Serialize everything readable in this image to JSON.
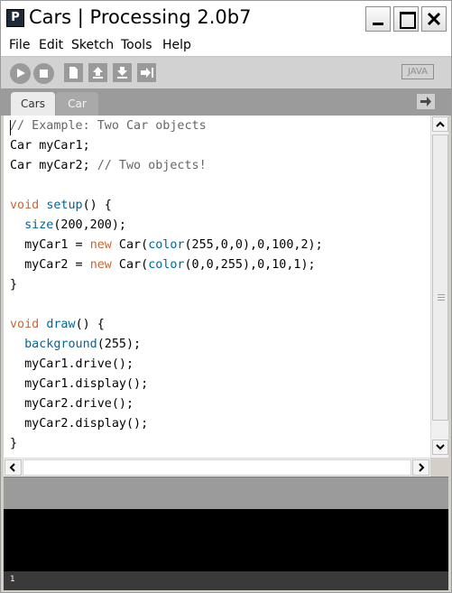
{
  "window": {
    "title": "Cars | Processing 2.0b7",
    "icon_letter": "P"
  },
  "menubar": {
    "items": [
      "File",
      "Edit",
      "Sketch",
      "Tools",
      "Help"
    ]
  },
  "toolbar": {
    "buttons": [
      "play-icon",
      "stop-icon",
      "new-icon",
      "open-icon",
      "save-icon",
      "export-icon"
    ],
    "mode": "JAVA"
  },
  "tabs": {
    "items": [
      {
        "label": "Cars",
        "active": true
      },
      {
        "label": "Car",
        "active": false
      }
    ],
    "menu_icon": "arrow-right-icon"
  },
  "editor": {
    "lines": [
      "// Example: Two Car objects",
      "Car myCar1;",
      "Car myCar2; // Two objects!",
      "",
      "void setup() {",
      "  size(200,200);",
      "  myCar1 = new Car(color(255,0,0),0,100,2);",
      "  myCar2 = new Car(color(0,0,255),0,10,1);",
      "}",
      "",
      "void draw() {",
      "  background(255);",
      "  myCar1.drive();",
      "  myCar1.display();",
      "  myCar2.drive();",
      "  myCar2.display();",
      "}"
    ]
  },
  "status": {
    "line_number": "1"
  },
  "colors": {
    "keyword": "#cc6633",
    "function": "#006699",
    "comment": "#666666",
    "console_bg": "#000000",
    "toolbar_bg": "#d2d2d2",
    "tabbar_bg": "#9b9b9b"
  }
}
